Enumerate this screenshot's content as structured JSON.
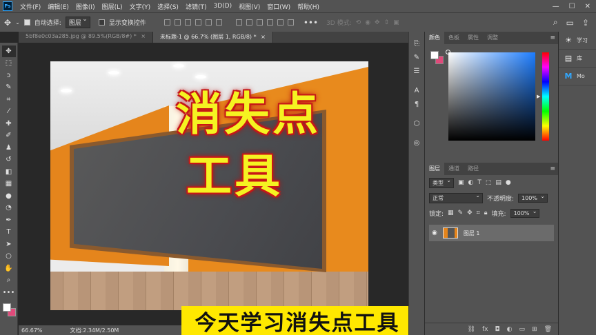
{
  "app": {
    "logo": "Ps"
  },
  "menu": [
    "文件(F)",
    "编辑(E)",
    "图像(I)",
    "图层(L)",
    "文字(Y)",
    "选择(S)",
    "滤镜(T)",
    "3D(D)",
    "视图(V)",
    "窗口(W)",
    "帮助(H)"
  ],
  "options": {
    "auto_select_label": "自动选择:",
    "auto_select_value": "图层",
    "show_transform_label": "显示变换控件",
    "mode_3d": "3D 模式:"
  },
  "tabs": [
    {
      "label": "5bf8e0c03a285.jpg @ 89.5%(RGB/8#) *",
      "close": "×"
    },
    {
      "label": "未标题-1 @ 66.7% (图层 1, RGB/8) *",
      "close": "×"
    }
  ],
  "canvas": {
    "title_line1": "消失点",
    "title_line2": "工具",
    "subtitle": "今天学习消失点工具"
  },
  "status": {
    "zoom": "66.67%",
    "doc": "文档:2.34M/2.50M"
  },
  "color_panel": {
    "tabs": [
      "颜色",
      "色板",
      "属性",
      "调整"
    ]
  },
  "layers_panel": {
    "tabs": [
      "图层",
      "通道",
      "路径"
    ],
    "filter_label": "类型",
    "blend_mode": "正常",
    "opacity_label": "不透明度:",
    "opacity_value": "100%",
    "lock_label": "锁定:",
    "fill_label": "填充:",
    "fill_value": "100%",
    "layers": [
      {
        "name": "图层 1"
      }
    ]
  },
  "learn_panel": {
    "items": [
      "学习",
      "库",
      "Mo"
    ]
  },
  "colors": {
    "foreground": "#ffffff",
    "background": "#e04a7a",
    "accent": "#31a8ff",
    "wall": "#e88a1d",
    "subtitle_bg": "#ffe800",
    "title_fill": "#f5f321",
    "title_outline": "#c41c1c"
  },
  "icons": {
    "tools": [
      "move-icon",
      "marquee-icon",
      "lasso-icon",
      "quick-select-icon",
      "crop-icon",
      "eyedropper-icon",
      "healing-brush-icon",
      "brush-icon",
      "stamp-icon",
      "history-brush-icon",
      "eraser-icon",
      "gradient-icon",
      "blur-icon",
      "dodge-icon",
      "pen-icon",
      "type-icon",
      "path-select-icon",
      "ellipse-icon",
      "hand-icon",
      "zoom-icon",
      "more-tools-icon"
    ]
  }
}
